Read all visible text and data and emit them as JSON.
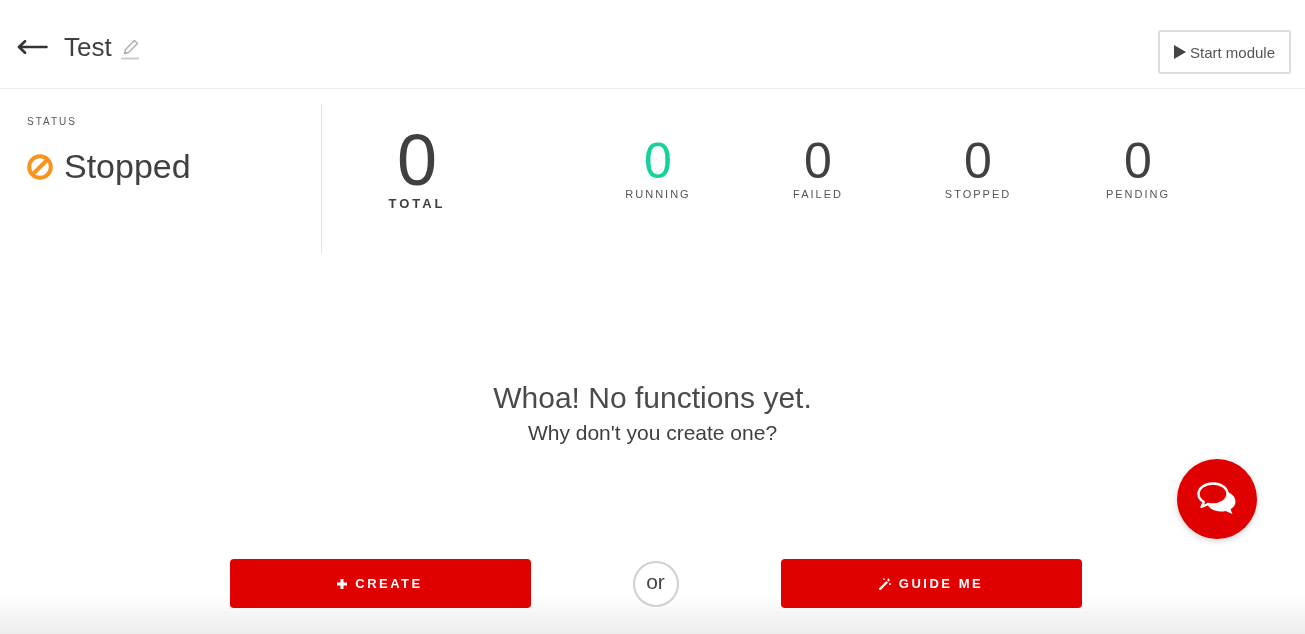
{
  "header": {
    "title": "Test",
    "start_button": "Start module"
  },
  "status": {
    "label": "STATUS",
    "value": "Stopped"
  },
  "total": {
    "value": "0",
    "label": "TOTAL"
  },
  "counters": [
    {
      "value": "0",
      "label": "RUNNING",
      "color": "#12d39b"
    },
    {
      "value": "0",
      "label": "FAILED",
      "color": "#404040"
    },
    {
      "value": "0",
      "label": "STOPPED",
      "color": "#404040"
    },
    {
      "value": "0",
      "label": "PENDING",
      "color": "#404040"
    }
  ],
  "empty_state": {
    "title": "Whoa! No functions yet.",
    "subtitle": "Why don't you create one?"
  },
  "actions": [
    {
      "kind": "create",
      "label": "CREATE"
    },
    {
      "kind": "guide",
      "label": "GUIDE ME"
    }
  ],
  "separator": "or"
}
